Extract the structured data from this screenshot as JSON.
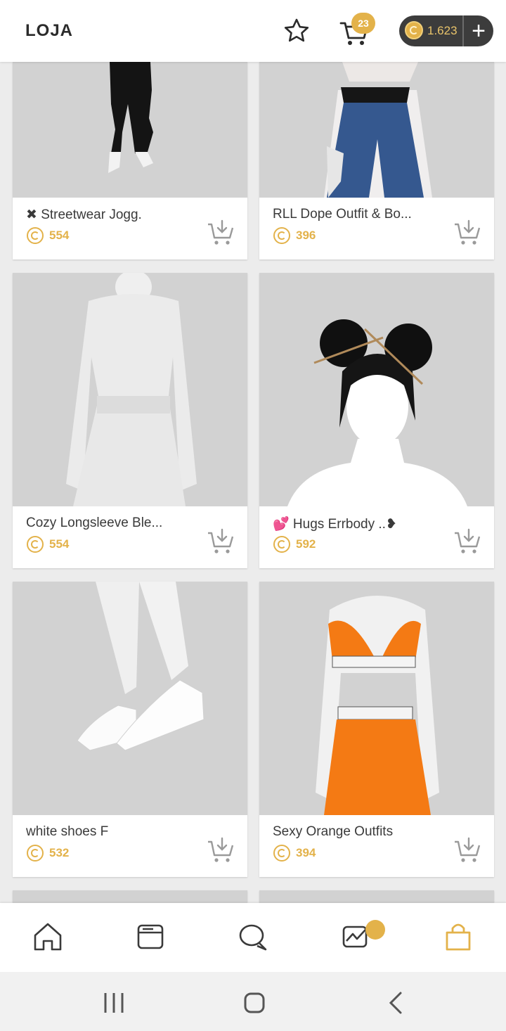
{
  "header": {
    "title": "LOJA",
    "cart_count": "23",
    "coins": "1.623",
    "add_coins_label": "+"
  },
  "products": [
    {
      "name": "✖ Streetwear Jogg.",
      "price": "554"
    },
    {
      "name": "RLL Dope Outfit & Bo...",
      "price": "396"
    },
    {
      "name": "Cozy Longsleeve Ble...",
      "price": "554"
    },
    {
      "name": "💕 Hugs Errbody ..❥",
      "price": "592"
    },
    {
      "name": "white shoes F",
      "price": "532"
    },
    {
      "name": "Sexy Orange Outfits",
      "price": "394"
    }
  ],
  "bottom_nav": [
    "home-icon",
    "browser-icon",
    "chat-icon",
    "activity-icon",
    "shop-bag-icon"
  ],
  "colors": {
    "accent": "#e3b24a",
    "dark": "#3c3c3c",
    "thumb_bg": "#d2d2d2"
  }
}
